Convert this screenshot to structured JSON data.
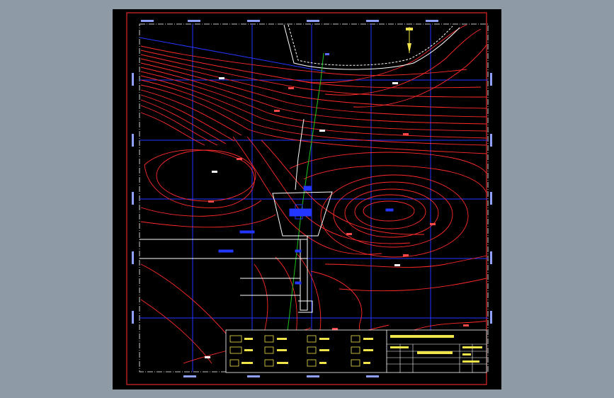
{
  "colors": {
    "viewport_bg": "#8e9aa6",
    "sheet_bg": "#000000",
    "border": "#e02828",
    "contour": "#ff2a2a",
    "grid": "#2336ff",
    "road": "#ffffff",
    "centerline": "#1ec21e",
    "legend_text": "#f1e34a"
  },
  "north_arrow_icon": "north-arrow-icon"
}
